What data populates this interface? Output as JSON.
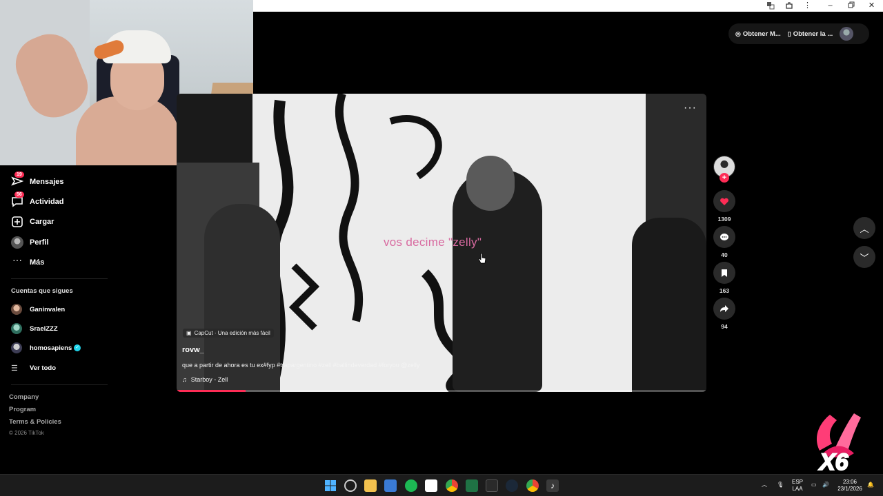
{
  "browser": {
    "icons": [
      "translate-icon",
      "extensions-icon",
      "menu-icon",
      "minimize-icon",
      "restore-icon",
      "close-icon"
    ]
  },
  "top_actions": {
    "get_app_label": "Obtener M...",
    "get_mobile_label": "Obtener la ..."
  },
  "sidebar": {
    "nav": [
      {
        "label": "Mensajes",
        "badge": "19",
        "icon": "paper-plane-icon"
      },
      {
        "label": "Actividad",
        "badge": "56",
        "icon": "chat-bubble-icon"
      },
      {
        "label": "Cargar",
        "badge": "",
        "icon": "plus-box-icon"
      },
      {
        "label": "Perfil",
        "badge": "",
        "icon": "avatar-icon"
      },
      {
        "label": "Más",
        "badge": "",
        "icon": "more-dots-icon"
      }
    ],
    "following_title": "Cuentas que sigues",
    "following": [
      {
        "name": "Ganinvalen",
        "verified": false
      },
      {
        "name": "SraelZZZ",
        "verified": false
      },
      {
        "name": "homosapiens",
        "verified": true
      }
    ],
    "see_all": "Ver todo",
    "footer": [
      "Company",
      "Program",
      "Terms & Policies"
    ],
    "copyright": "© 2026 TikTok"
  },
  "video": {
    "caption_overlay": "vos decime \"zelly\"",
    "capcut_label": "CapCut · Una edición más fácil",
    "author": "rovw_",
    "description": "que a partir de ahora es tu ex#fyp #trapargentino #zell #ballindeverdad #foryou @zelly",
    "music": "Starboy - Zell",
    "progress": 0.13
  },
  "actions": {
    "likes": "1309",
    "comments": "40",
    "saves": "163",
    "shares": "94"
  },
  "combo_overlay": "X6",
  "taskbar": {
    "language": "ESP",
    "layout": "LAA",
    "time": "23:06",
    "date": "23/1/2026"
  },
  "colors": {
    "accent": "#fe2c55",
    "caption": "#d86aa0",
    "verified": "#20d5ec"
  }
}
